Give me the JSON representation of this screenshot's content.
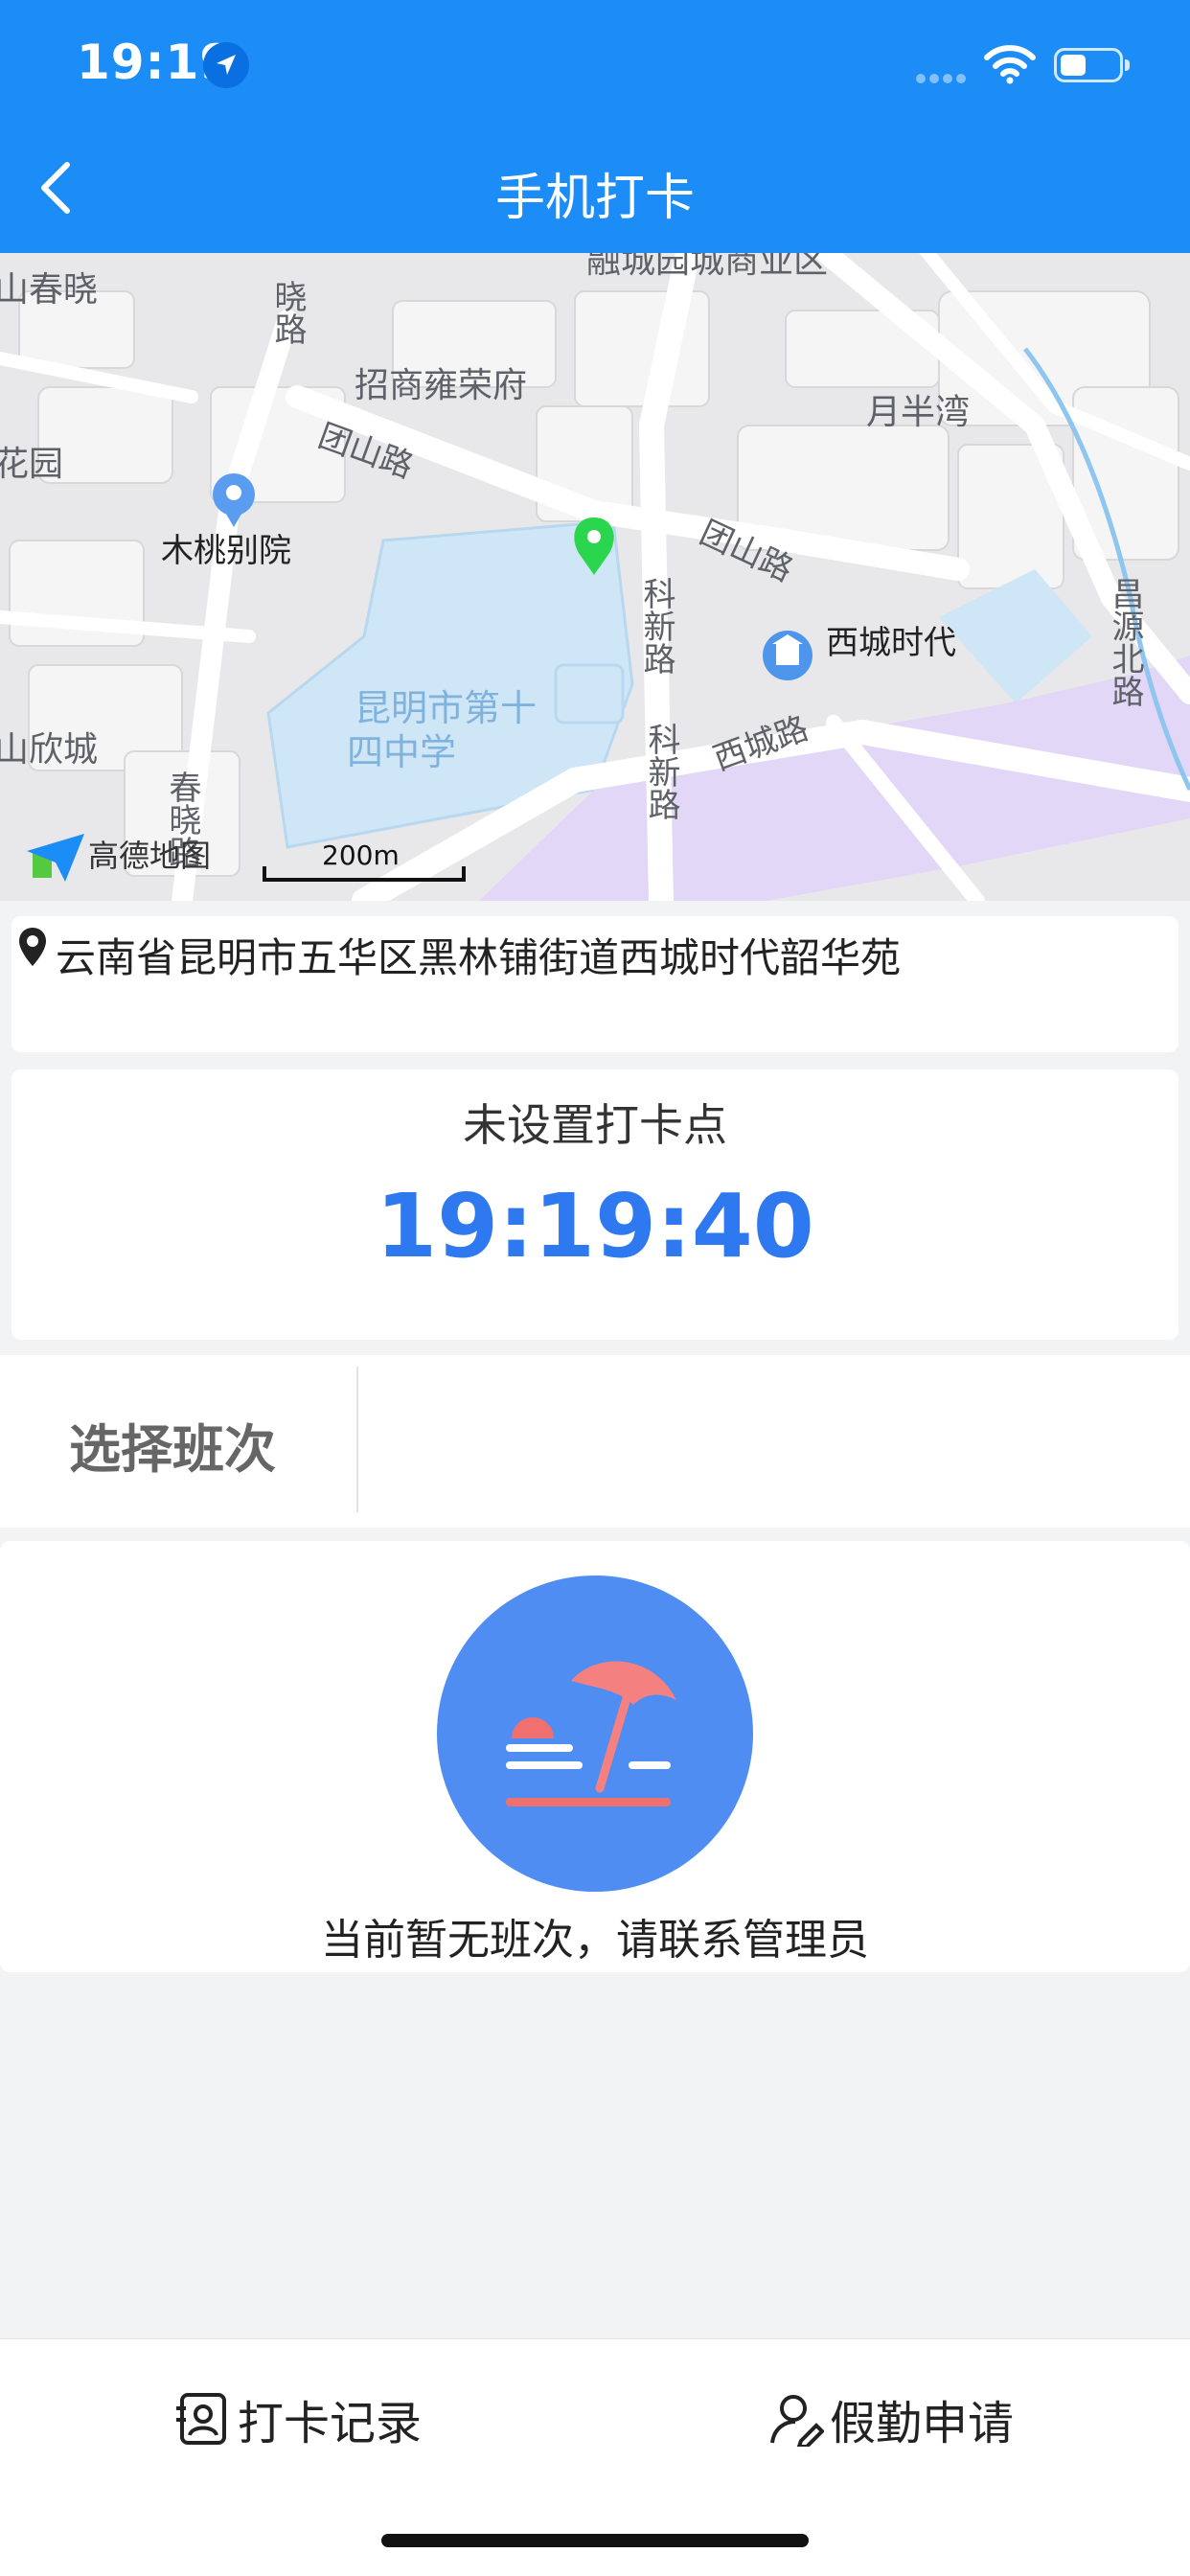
{
  "status_bar": {
    "time": "19:19"
  },
  "header": {
    "title": "手机打卡",
    "back_icon": "chevron-left-icon"
  },
  "map": {
    "labels": {
      "chunxiao_top": "山春晓",
      "xiao_road": "晓路",
      "rong_city": "融城园城商业区",
      "zhaoshang": "招商雍荣府",
      "yueban": "月半湾",
      "huayuan": "花园",
      "tuanshan_road": "团山路",
      "mutao": "木桃别院",
      "tuanshan_road2": "团山路",
      "kexin_road": "科新路",
      "changyuan_road": "昌源北路",
      "xicheng_shidai": "西城时代",
      "school": "昆明市第十四中学",
      "kexin_road2": "科新路",
      "xicheng_road": "西城路",
      "xincheng": "山欣城",
      "chunxiao_road": "春晓路",
      "brand": "高德地图",
      "scale": "200m"
    }
  },
  "address": {
    "text": "云南省昆明市五华区黑林铺街道西城时代韶华苑",
    "icon": "location-pin-icon"
  },
  "clock": {
    "label": "未设置打卡点",
    "time": "19:19:40"
  },
  "shift": {
    "label": "选择班次",
    "value": ""
  },
  "empty_state": {
    "text": "当前暂无班次，请联系管理员",
    "icon": "beach-umbrella-icon"
  },
  "tabbar": {
    "records_label": "打卡记录",
    "records_icon": "clock-record-icon",
    "leave_label": "假勤申请",
    "leave_icon": "user-edit-icon"
  },
  "colors": {
    "header": "#1c8cf6",
    "accent": "#2f79f0",
    "illustration_bg": "#4f8df2"
  }
}
